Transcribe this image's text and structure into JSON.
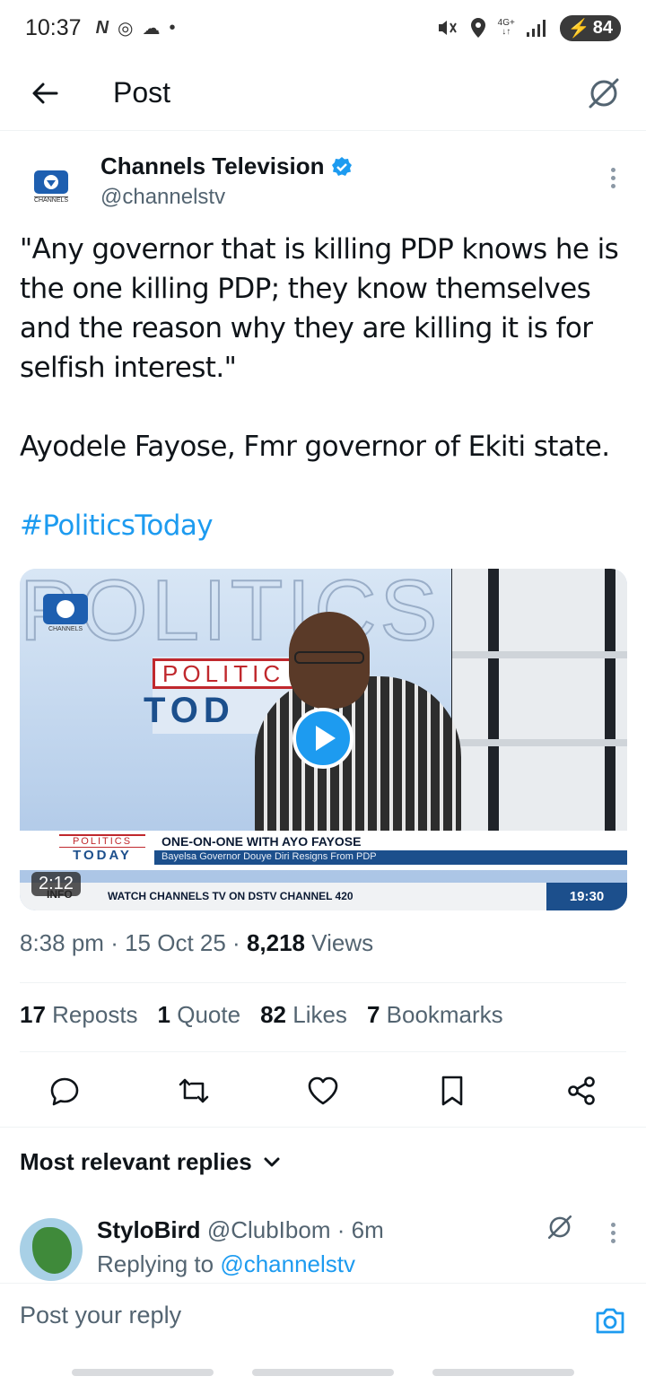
{
  "status_bar": {
    "time": "10:37",
    "left_glyphs": [
      "N",
      "◎",
      "☁",
      "•"
    ],
    "net_top": "4G+",
    "net_bottom": "↓↑",
    "battery": "84"
  },
  "header": {
    "title": "Post"
  },
  "post": {
    "author_name": "Channels Television",
    "author_handle": "@channelstv",
    "avatar_label": "CHANNELS",
    "text_quote": "\"Any governor that is killing PDP knows he is the one killing PDP; they know themselves and the reason why they are killing it is for selfish interest.\"",
    "text_attribution": "Ayodele Fayose, Fmr governor of Ekiti state.",
    "hashtag": "#PoliticsToday",
    "media": {
      "duration": "2:12",
      "logo_label": "CHANNELS",
      "show_title_1": "POLITIC",
      "show_title_2": "TOD",
      "lt_logo_1": "POLITICS",
      "lt_logo_2": "TODAY",
      "lt_headline": "ONE-ON-ONE WITH AYO FAYOSE",
      "lt_sub": "Bayelsa Governor Douye Diri Resigns From PDP",
      "ticker_info": "INFO",
      "ticker_text": "WATCH CHANNELS TV ON DSTV CHANNEL 420",
      "ticker_time": "19:30"
    },
    "meta_time": "8:38 pm",
    "meta_date": "15 Oct 25",
    "meta_views_count": "8,218",
    "meta_views_label": "Views",
    "stats": {
      "reposts_count": "17",
      "reposts_label": "Reposts",
      "quotes_count": "1",
      "quotes_label": "Quote",
      "likes_count": "82",
      "likes_label": "Likes",
      "bookmarks_count": "7",
      "bookmarks_label": "Bookmarks"
    }
  },
  "replies": {
    "sort_label": "Most relevant replies",
    "items": [
      {
        "name": "StyloBird",
        "handle": "@ClubIbom",
        "time": "6m",
        "replying_prefix": "Replying to",
        "replying_to": "@channelstv"
      }
    ]
  },
  "compose": {
    "placeholder": "Post your reply"
  },
  "colors": {
    "accent": "#1d9bf0",
    "text": "#0f1419",
    "muted": "#536471"
  },
  "icons": [
    "back-arrow-icon",
    "grok-icon",
    "verified-badge-icon",
    "more-icon",
    "play-icon",
    "reply-icon",
    "repost-icon",
    "like-icon",
    "bookmark-icon",
    "share-icon",
    "chevron-down-icon",
    "camera-icon"
  ]
}
